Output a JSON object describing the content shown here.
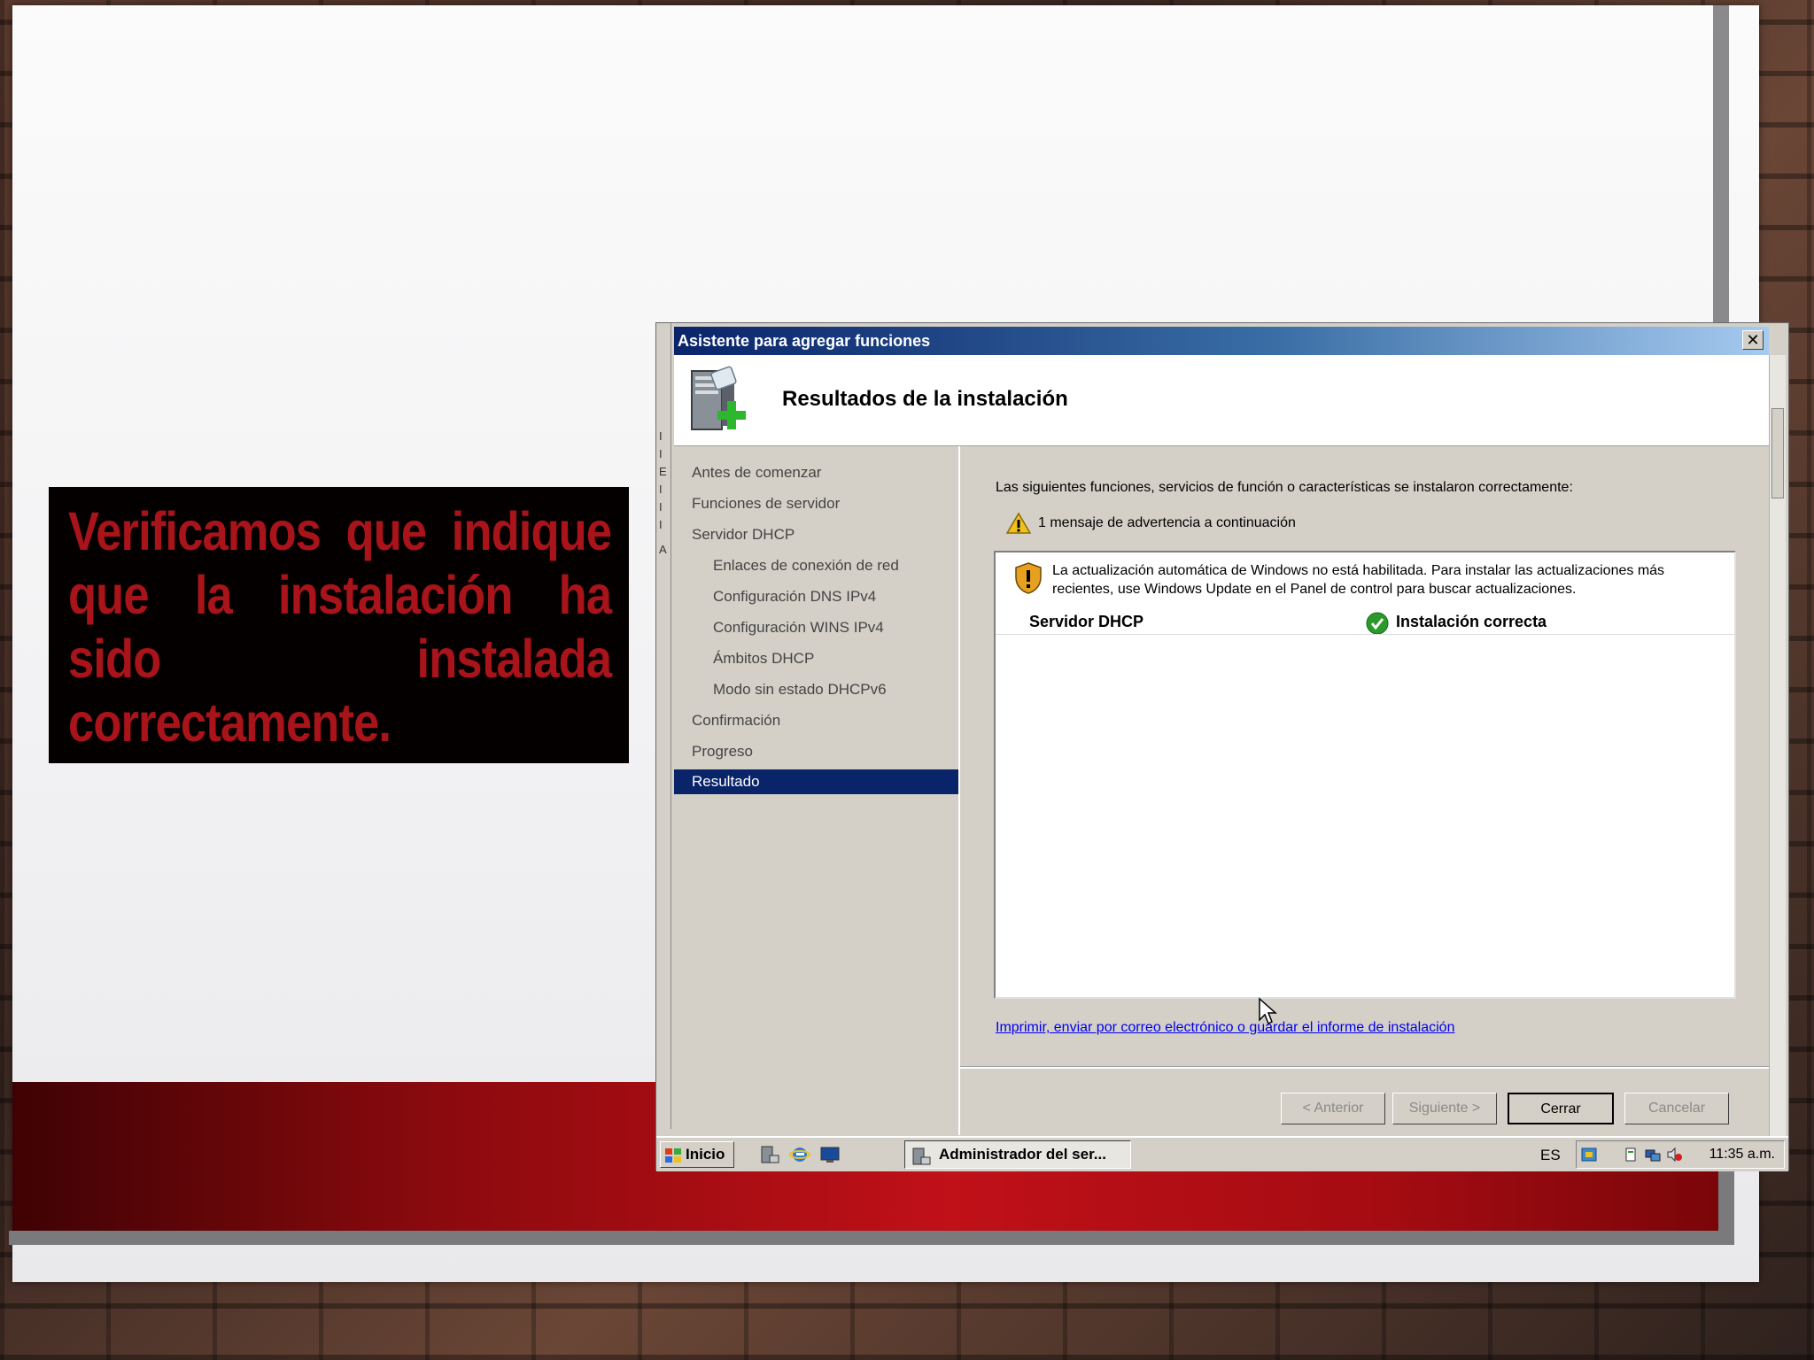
{
  "slide": {
    "callout_text": "Verificamos que indique que la instalación ha sido instalada correctamente."
  },
  "window": {
    "title": "Asistente para agregar funciones",
    "close_label": "✕",
    "header_title": "Resultados de la instalación",
    "nav": [
      {
        "label": "Antes de comenzar"
      },
      {
        "label": "Funciones de servidor"
      },
      {
        "label": "Servidor DHCP"
      },
      {
        "label": "Enlaces de conexión de red"
      },
      {
        "label": "Configuración DNS IPv4"
      },
      {
        "label": "Configuración WINS IPv4"
      },
      {
        "label": "Ámbitos DHCP"
      },
      {
        "label": "Modo sin estado DHCPv6"
      },
      {
        "label": "Confirmación"
      },
      {
        "label": "Progreso"
      },
      {
        "label": "Resultado"
      }
    ],
    "intro_text": "Las siguientes funciones, servicios de función o características se instalaron correctamente:",
    "warning_summary": "1 mensaje de advertencia a continuación",
    "warning_notice": "La actualización automática de Windows no está habilitada. Para instalar las actualizaciones más recientes, use Windows Update en el Panel de control para buscar actualizaciones.",
    "result_role": "Servidor DHCP",
    "result_status": "Instalación correcta",
    "report_link": "Imprimir, enviar por correo electrónico o guardar el informe de instalación",
    "buttons": {
      "back": "< Anterior",
      "next": "Siguiente >",
      "close": "Cerrar",
      "cancel": "Cancelar"
    }
  },
  "taskbar": {
    "start_label": "Inicio",
    "task_label": "Administrador del ser...",
    "language": "ES",
    "clock": "11:35 a.m."
  },
  "colors": {
    "callout_text": "#a8141a",
    "title_bar": "#0a246a",
    "selection": "#0a246a",
    "link": "#0000ee",
    "success": "#2a9a2a",
    "warning": "#f0c020"
  }
}
